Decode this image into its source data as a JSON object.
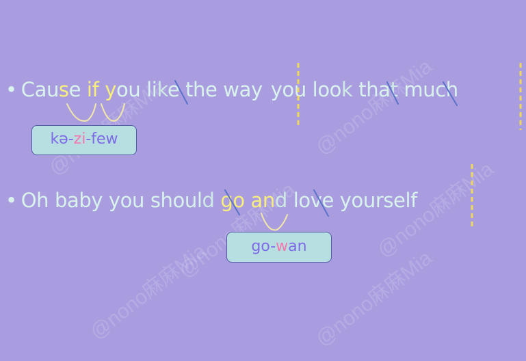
{
  "colors": {
    "background": "#a99ddf",
    "lyric_text": "#d9f3ec",
    "linked_letters": "#f7ee7d",
    "pause_marker": "#f0d85a",
    "elision_slash": "#5a72c8",
    "link_arc": "#f2e8a8",
    "box_fill": "#b7dee0",
    "box_border": "#4f5aa3",
    "phonetic_purple": "#7d6ae6",
    "phonetic_pink": "#f278ae"
  },
  "watermark": "@nono麻麻Mia",
  "lyrics": {
    "line1": {
      "bullet": "•",
      "seg1": "Cau",
      "seg2": "s",
      "seg3": "e",
      "seg4": " ",
      "seg5": "if",
      "seg6": " ",
      "seg7": "y",
      "seg8": "ou li",
      "seg9": "k",
      "seg10": "e the way",
      "seg11": "you loo",
      "seg12": "k",
      "seg13": " tha",
      "seg14": "t",
      "seg15": " much"
    },
    "line2": {
      "bullet": "•",
      "seg1": "Oh baby you shoul",
      "seg2": "d",
      "seg3": " ",
      "seg4": "go",
      "seg5": " ",
      "seg6": "an",
      "seg7": "d",
      "seg8": " love yourself"
    }
  },
  "phonetics": {
    "box1": {
      "p1": "kə-",
      "p2": "zi",
      "p3": "-few"
    },
    "box2": {
      "p1": "go-",
      "p2": "w",
      "p3": "an"
    }
  }
}
